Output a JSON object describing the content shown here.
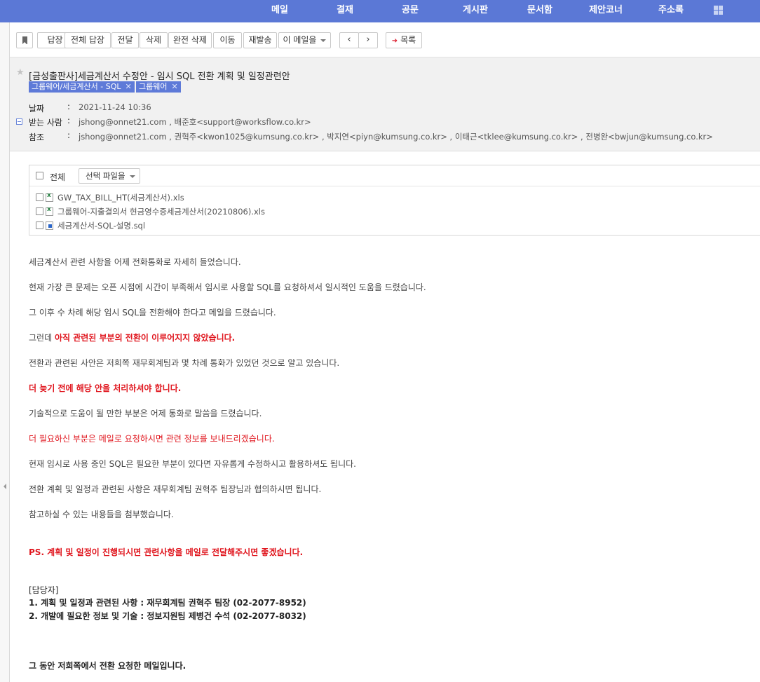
{
  "nav": {
    "items": [
      "메일",
      "결재",
      "공문",
      "게시판",
      "문서함",
      "제안코너",
      "주소록"
    ]
  },
  "toolbar": {
    "reply": "답장",
    "reply_all": "전체 답장",
    "forward": "전달",
    "delete": "삭제",
    "delete_permanently": "완전 삭제",
    "move": "이동",
    "resend": "재발송",
    "this_mail": "이 메일을",
    "list": "목록"
  },
  "mail": {
    "subject": "[금성출판사]세금계산서 수정안 - 임시 SQL 전환 계획 및 일정관련안",
    "tags": [
      "그룹웨어/세금계산서 - SQL",
      "그룹웨어"
    ],
    "date_label": "날짜",
    "date": "2021-11-24 10:36",
    "to_label": "받는 사람",
    "to": "jshong@onnet21.com ,   배준호<support@worksflow.co.kr>",
    "cc_label": "참조",
    "cc": "jshong@onnet21.com ,   권혁주<kwon1025@kumsung.co.kr> ,   박지연<piyn@kumsung.co.kr> ,   이태근<tklee@kumsung.co.kr> ,   전병완<bwjun@kumsung.co.kr>"
  },
  "attachments": {
    "all_label": "전체",
    "select_label": "선택 파일을",
    "files": [
      {
        "name": "GW_TAX_BILL_HT(세금계산서).xls",
        "icon": "excel-file-icon"
      },
      {
        "name": "그룹웨어-지출결의서 현금영수증세금계산서(20210806).xls",
        "icon": "excel-file-icon"
      },
      {
        "name": "세금계산서-SQL-설명.sql",
        "icon": "sql-file-icon"
      }
    ]
  },
  "body": {
    "p1": "세금계산서 관련 사항을 어제 전화통화로 자세히 들었습니다.",
    "p2": "현재 가장 큰 문제는 오픈 시점에 시간이 부족해서 임시로 사용할 SQL를 요청하셔서 일시적인 도움을 드렸습니다.",
    "p3": "그 이후 수 차례 해당 임시 SQL을 전환해야 한다고 메일을 드렸습니다.",
    "p4_prefix": "그런데 ",
    "p4_red": "아직 관련된 부분의 전환이 이루어지지 않았습니다.",
    "p5": "전환과 관련된 사안은 저희쪽 재무회계팀과 몇 차례 통화가 있었던 것으로 알고 있습니다.",
    "p6": "더 늦기 전에 해당 안을 처리하셔야 합니다.",
    "p7": "기술적으로 도움이 될 만한 부분은 어제 통화로 말씀을 드렸습니다.",
    "p8": "더 필요하신 부분은 메일로 요청하시면 관련 정보를 보내드리겠습니다.",
    "p9": "현재 임시로 사용 중인 SQL은 필요한 부분이 있다면 자유롭게 수정하시고 활용하셔도 됩니다.",
    "p10": "전환 계획 및 일정과 관련된 사항은 재무회계팀 권혁주 팀장님과 협의하시면 됩니다.",
    "p11": "참고하실 수 있는 내용들을 첨부했습니다.",
    "ps": "PS. 계획 및 일정이 진행되시면 관련사항을 메일로 전달해주시면 좋겠습니다.",
    "contact_title": "[담당자]",
    "contact1": "1. 계획 및 일정과 관련된 사항 : 재무회계팀 권혁주 팀장 (02-2077-8952)",
    "contact2": "2. 개발에 필요한 정보 및 기술 : 정보지원팀 제병건 수석 (02-2077-8032)",
    "closing": "그 동안 저희쪽에서 전환 요청한 메일입니다."
  }
}
